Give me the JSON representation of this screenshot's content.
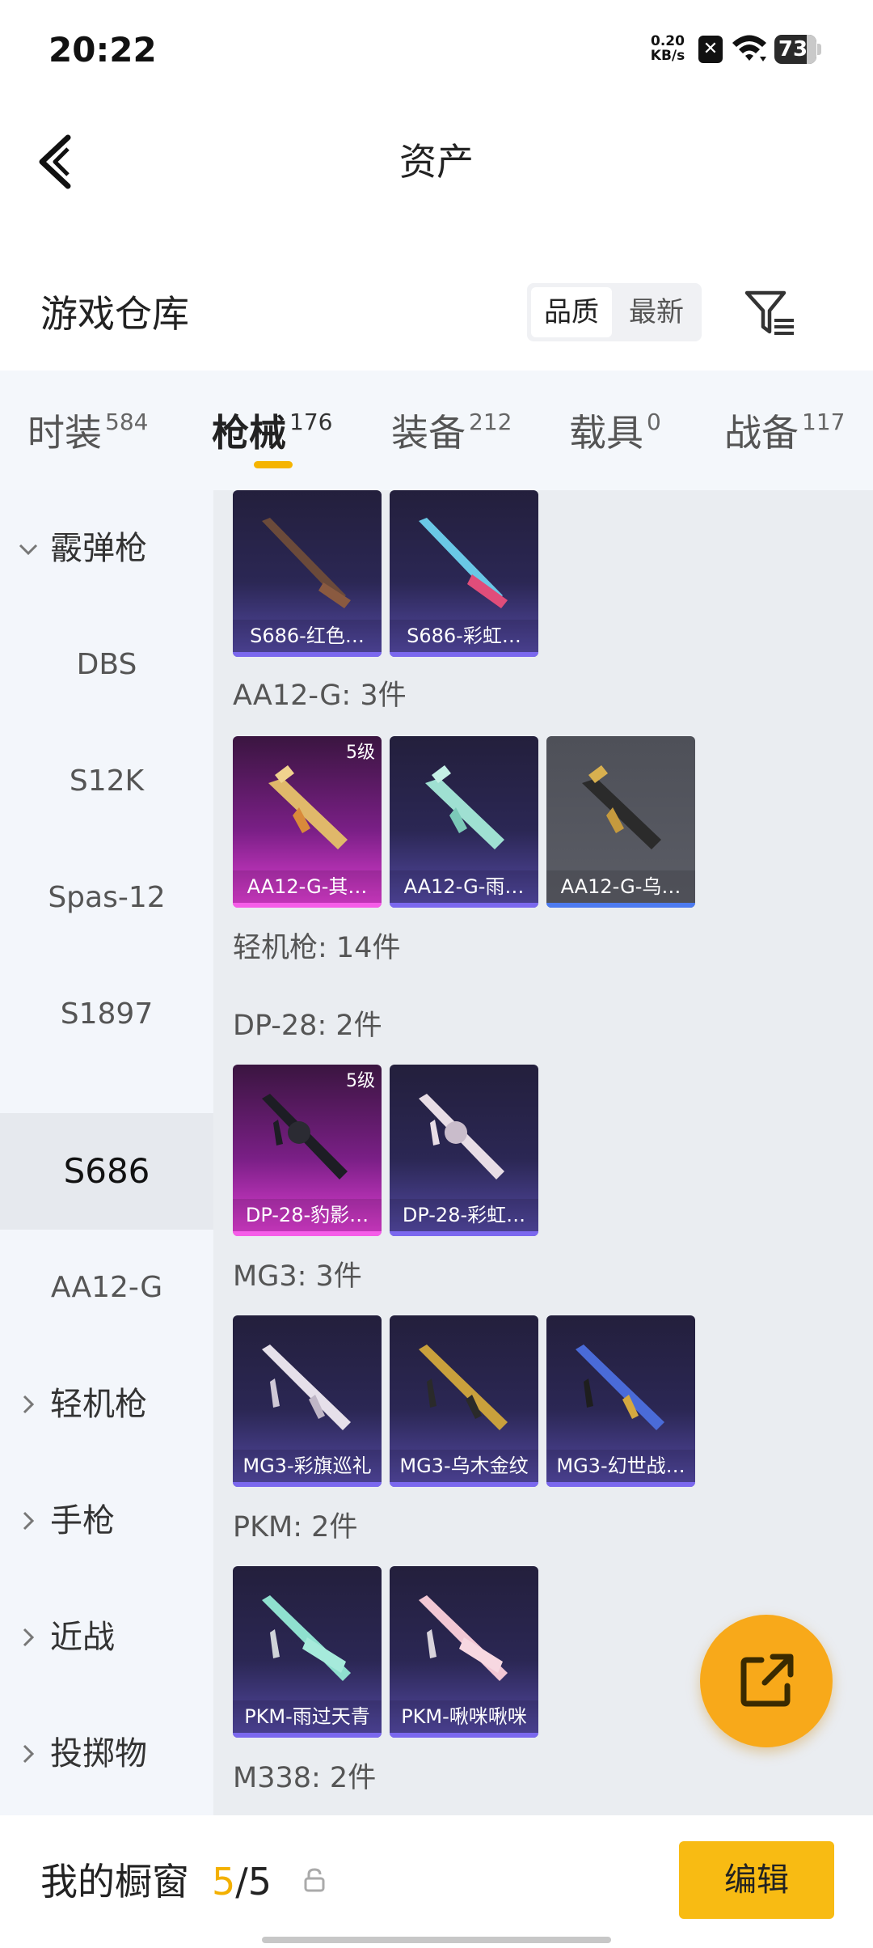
{
  "status_bar": {
    "time": "20:22",
    "net_speed_value": "0.20",
    "net_speed_unit": "KB/s",
    "battery": "73"
  },
  "header": {
    "title": "资产"
  },
  "section": {
    "title": "游戏仓库",
    "sort_options": [
      "品质",
      "最新"
    ]
  },
  "tabs": [
    {
      "label": "时装",
      "count": "584"
    },
    {
      "label": "枪械",
      "count": "176"
    },
    {
      "label": "装备",
      "count": "212"
    },
    {
      "label": "载具",
      "count": "0"
    },
    {
      "label": "战备",
      "count": "117"
    }
  ],
  "sidebar": {
    "items": [
      {
        "label": "霰弹枪"
      },
      {
        "label": "DBS"
      },
      {
        "label": "S12K"
      },
      {
        "label": "Spas-12"
      },
      {
        "label": "S1897"
      },
      {
        "label": "S686"
      },
      {
        "label": "AA12-G"
      },
      {
        "label": "轻机枪"
      },
      {
        "label": "手枪"
      },
      {
        "label": "近战"
      },
      {
        "label": "投掷物"
      }
    ]
  },
  "content": {
    "groups": {
      "aa12": "AA12-G: 3件",
      "lmg": "轻机枪: 14件",
      "dp28": "DP-28: 2件",
      "mg3": "MG3: 3件",
      "pkm": "PKM: 2件",
      "m338": "M338: 2件"
    },
    "cards": {
      "s686_1": {
        "label": "S686-红色…"
      },
      "s686_2": {
        "label": "S686-彩虹…"
      },
      "aa12_1": {
        "label": "AA12-G-其…",
        "badge": "5级"
      },
      "aa12_2": {
        "label": "AA12-G-雨…"
      },
      "aa12_3": {
        "label": "AA12-G-乌…"
      },
      "dp28_1": {
        "label": "DP-28-豹影…",
        "badge": "5级"
      },
      "dp28_2": {
        "label": "DP-28-彩虹…"
      },
      "mg3_1": {
        "label": "MG3-彩旗巡礼"
      },
      "mg3_2": {
        "label": "MG3-乌木金纹"
      },
      "mg3_3": {
        "label": "MG3-幻世战…"
      },
      "pkm_1": {
        "label": "PKM-雨过天青"
      },
      "pkm_2": {
        "label": "PKM-啾咪啾咪"
      }
    }
  },
  "bottom": {
    "showcase_label": "我的橱窗",
    "showcase_current": "5",
    "showcase_sep": "/",
    "showcase_total": "5",
    "edit_label": "编辑"
  },
  "colors": {
    "accent": "#f8bb13",
    "tab_indicator": "#f5b400",
    "rare_pink": "#e23fd5",
    "epic_purple": "#554aa6"
  }
}
